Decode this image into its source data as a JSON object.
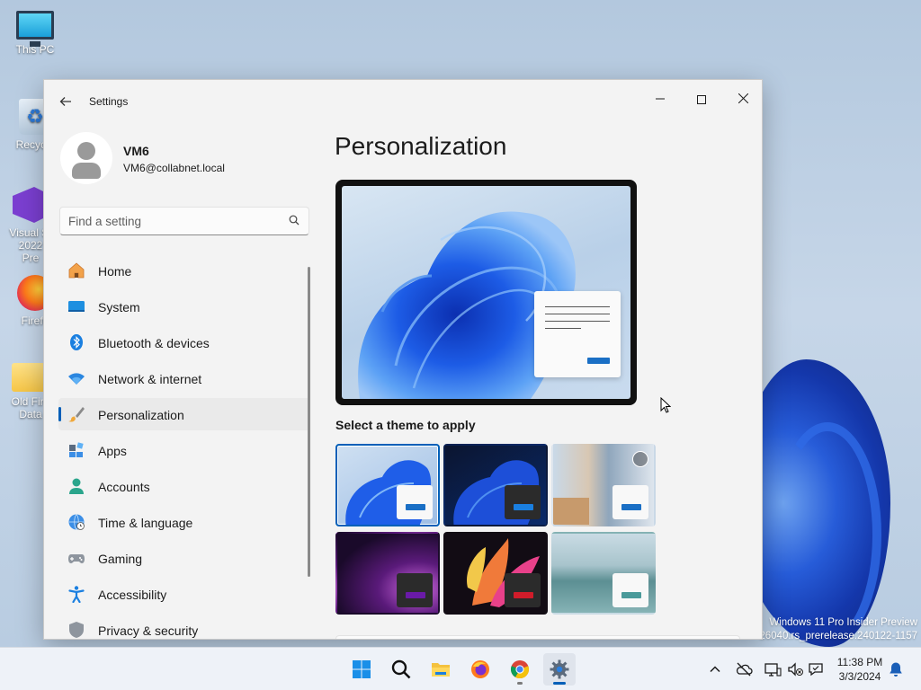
{
  "desktop": {
    "icons": [
      {
        "label": "This PC",
        "icon": "this-pc-icon"
      },
      {
        "label": "Recycle",
        "icon": "recycle-bin-icon"
      },
      {
        "label": "Visual St 2022 Pre",
        "icon": "visual-studio-icon"
      },
      {
        "label": "Firefo",
        "icon": "firefox-icon"
      },
      {
        "label": "Old Fire Data",
        "icon": "folder-icon"
      }
    ],
    "watermark": {
      "line1": "Windows 11 Pro Insider Preview",
      "line2": "26040.rs_prerelease.240122-1157"
    }
  },
  "window": {
    "title": "Settings",
    "controls": {
      "minimize": "minimize-icon",
      "maximize": "maximize-icon",
      "close": "close-icon"
    }
  },
  "user": {
    "name": "VM6",
    "email": "VM6@collabnet.local"
  },
  "search": {
    "placeholder": "Find a setting",
    "value": ""
  },
  "nav": {
    "items": [
      {
        "label": "Home",
        "icon": "home-icon"
      },
      {
        "label": "System",
        "icon": "system-icon"
      },
      {
        "label": "Bluetooth & devices",
        "icon": "bluetooth-icon"
      },
      {
        "label": "Network & internet",
        "icon": "wifi-icon"
      },
      {
        "label": "Personalization",
        "icon": "paintbrush-icon",
        "active": true
      },
      {
        "label": "Apps",
        "icon": "apps-icon"
      },
      {
        "label": "Accounts",
        "icon": "accounts-icon"
      },
      {
        "label": "Time & language",
        "icon": "globe-clock-icon"
      },
      {
        "label": "Gaming",
        "icon": "gamepad-icon"
      },
      {
        "label": "Accessibility",
        "icon": "accessibility-icon"
      },
      {
        "label": "Privacy & security",
        "icon": "shield-icon"
      }
    ]
  },
  "content": {
    "page_title": "Personalization",
    "theme_section_label": "Select a theme to apply",
    "themes": [
      {
        "name": "windows-light",
        "selected": true
      },
      {
        "name": "windows-dark",
        "selected": false
      },
      {
        "name": "spotlight",
        "selected": false
      },
      {
        "name": "glow",
        "selected": false
      },
      {
        "name": "captured-motion",
        "selected": false
      },
      {
        "name": "flow",
        "selected": false
      }
    ]
  },
  "taskbar": {
    "apps": [
      {
        "name": "start",
        "icon": "windows-start-icon"
      },
      {
        "name": "search",
        "icon": "search-icon"
      },
      {
        "name": "file-explorer",
        "icon": "folder-icon"
      },
      {
        "name": "firefox",
        "icon": "firefox-icon"
      },
      {
        "name": "chrome",
        "icon": "chrome-icon",
        "running": true
      },
      {
        "name": "settings",
        "icon": "gear-icon",
        "active": true
      }
    ],
    "tray": [
      "chevron-up-icon",
      "onedrive-offline-icon",
      "network-icon",
      "volume-muted-icon",
      "chat-icon"
    ],
    "time": "11:38 PM",
    "date": "3/3/2024",
    "notification_icon": "bell-icon"
  },
  "colors": {
    "accent": "#005fb8",
    "window_bg": "#f3f3f3",
    "taskbar_bg": "#eef2f8"
  }
}
